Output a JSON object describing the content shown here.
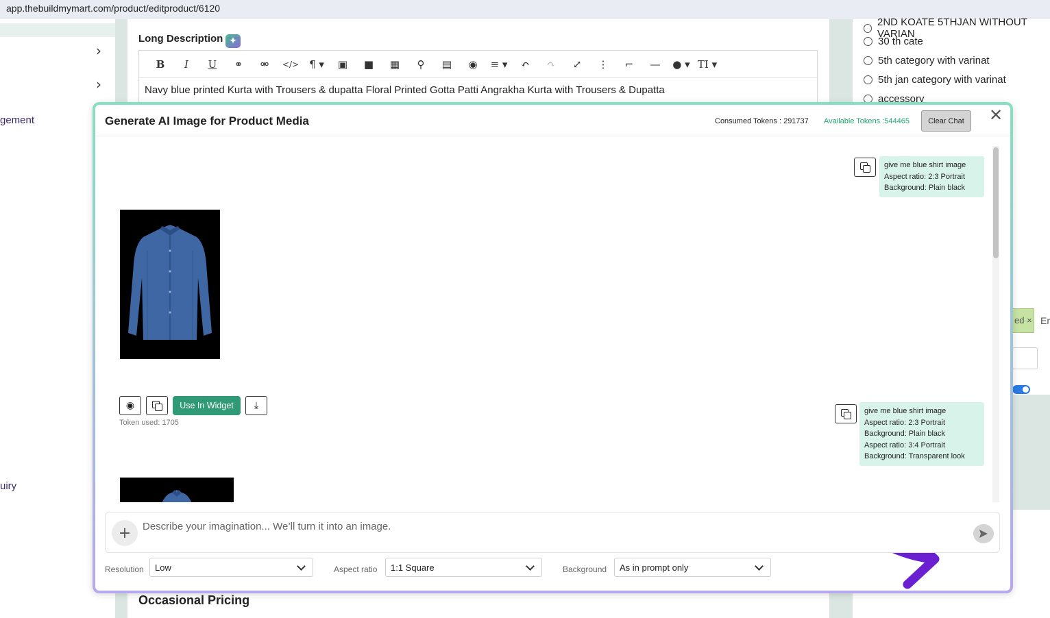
{
  "browser": {
    "url": "app.thebuildmymart.com/product/editproduct/6120"
  },
  "background": {
    "sidebar": {
      "management_fragment": "gement",
      "inquiry_fragment": "uiry"
    },
    "long_description": {
      "label": "Long Description",
      "text": "Navy blue printed Kurta with Trousers & dupatta Floral Printed Gotta Patti Angrakha Kurta with Trousers & Dupatta"
    },
    "categories": [
      "2ND KOATE 5THJAN WITHOUT VARIAN",
      "30 th cate",
      "5th category with varinat",
      "5th jan category with varinat",
      "accessory"
    ],
    "tag_fragment": "ed ×",
    "input_fragment": "En",
    "occasional_pricing_label": "Occasional Pricing"
  },
  "modal": {
    "title": "Generate AI Image for Product Media",
    "consumed_tokens": "Consumed Tokens : 291737",
    "available_tokens": "Available Tokens :544465",
    "clear_chat_label": "Clear Chat",
    "messages": [
      {
        "role": "user",
        "lines": [
          "give me blue shirt image",
          "Aspect ratio: 2:3 Portrait",
          "Background: Plain black"
        ]
      },
      {
        "role": "assistant",
        "image": "blue-shirt-on-black",
        "use_in_widget_label": "Use In Widget",
        "token_used": "Token used: 1705"
      },
      {
        "role": "user",
        "lines": [
          "give me blue shirt image",
          "Aspect ratio: 2:3 Portrait",
          "Background: Plain black",
          "Aspect ratio: 3:4 Portrait",
          "Background: Transparent look"
        ]
      },
      {
        "role": "assistant",
        "image": "blue-shirt-on-black"
      }
    ],
    "prompt_placeholder": "Describe your imagination... We’ll turn it into an image.",
    "options": {
      "resolution": {
        "label": "Resolution",
        "value": "Low"
      },
      "aspect_ratio": {
        "label": "Aspect ratio",
        "value": "1:1 Square"
      },
      "background": {
        "label": "Background",
        "value": "As in prompt only"
      }
    }
  },
  "colors": {
    "accent_green": "#2f9a75",
    "available_tokens_green": "#23a770",
    "bubble_bg": "#d8f3ea",
    "annotation_arrow": "#6a1fd0"
  }
}
